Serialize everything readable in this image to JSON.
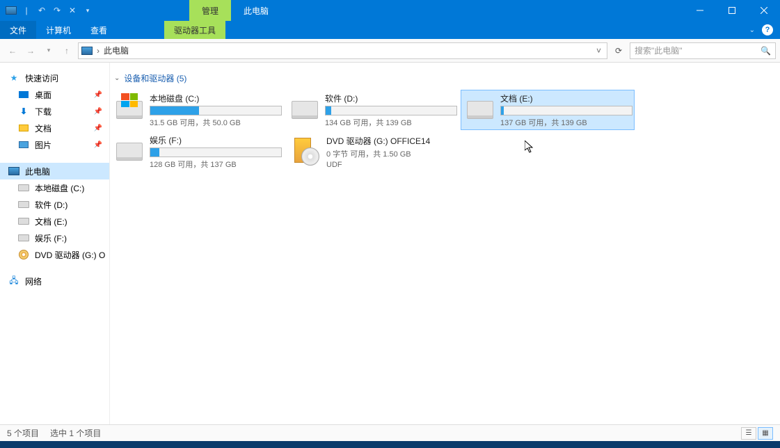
{
  "titlebar": {
    "manage_tab": "管理",
    "thispc_tab": "此电脑"
  },
  "ribbon": {
    "file": "文件",
    "computer": "计算机",
    "view": "查看",
    "drive_tools": "驱动器工具"
  },
  "addressbar": {
    "sep": "›",
    "location": "此电脑"
  },
  "search": {
    "placeholder": "搜索\"此电脑\""
  },
  "sidebar": {
    "quick_access": "快速访问",
    "desktop": "桌面",
    "downloads": "下载",
    "documents": "文档",
    "pictures": "图片",
    "this_pc": "此电脑",
    "drive_c": "本地磁盘 (C:)",
    "drive_d": "软件 (D:)",
    "drive_e": "文档 (E:)",
    "drive_f": "娱乐 (F:)",
    "drive_g": "DVD 驱动器 (G:) O",
    "network": "网络"
  },
  "content": {
    "group_title": "设备和驱动器 (5)",
    "drives": {
      "c": {
        "name": "本地磁盘 (C:)",
        "sub": "31.5 GB 可用，共 50.0 GB",
        "fill": 37
      },
      "d": {
        "name": "软件 (D:)",
        "sub": "134 GB 可用，共 139 GB",
        "fill": 4
      },
      "e": {
        "name": "文档 (E:)",
        "sub": "137 GB 可用，共 139 GB",
        "fill": 2
      },
      "f": {
        "name": "娱乐 (F:)",
        "sub": "128 GB 可用，共 137 GB",
        "fill": 7
      },
      "g": {
        "name": "DVD 驱动器 (G:) OFFICE14",
        "sub": "0 字节 可用，共 1.50 GB",
        "sub2": "UDF"
      }
    }
  },
  "statusbar": {
    "items": "5 个项目",
    "selected": "选中 1 个项目"
  }
}
